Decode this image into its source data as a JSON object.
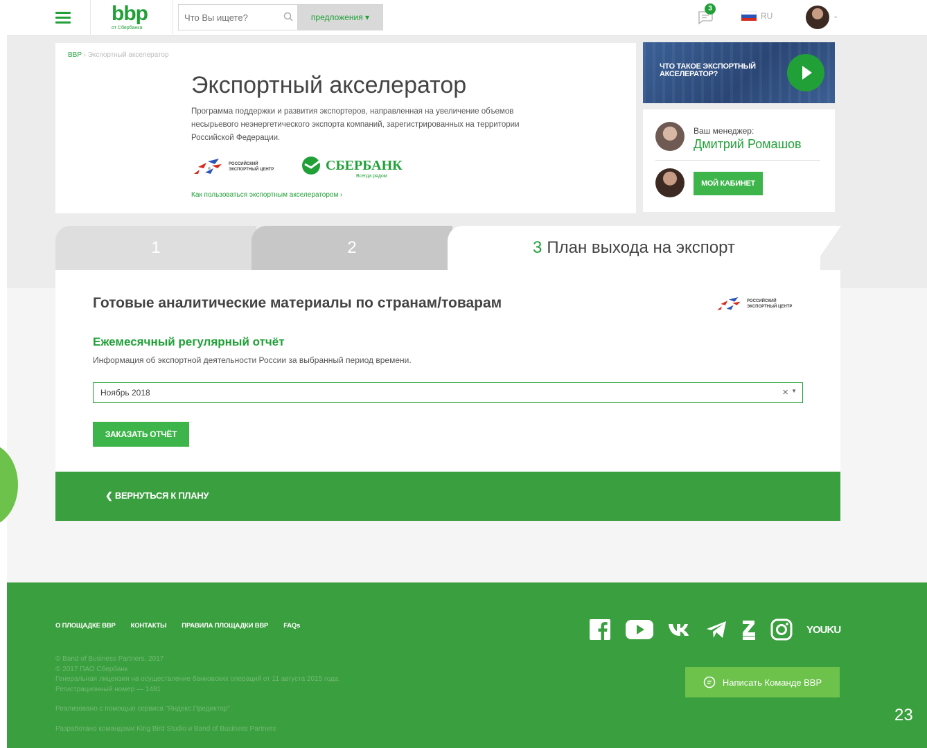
{
  "header": {
    "logo": "bbp",
    "logo_sub": "от Сбербанка",
    "search_placeholder": "Что Вы ищете?",
    "offers_label": "предложения ▾",
    "notifications_count": "3",
    "lang": "RU"
  },
  "top": {
    "breadcrumb": {
      "home": "BBP",
      "sep": " › ",
      "current": "Экспортный акселератор"
    },
    "title": "Экспортный акселератор",
    "description": "Программа поддержки и развития экспортеров, направленная на увеличение объемов несырьевого неэнергетического экспорта компаний, зарегистрированных на территории Российской Федерации.",
    "rec_logo_line1": "РОССИЙСКИЙ",
    "rec_logo_line2": "ЭКСПОРТНЫЙ ЦЕНТР",
    "sber_logo": "СБЕРБАНК",
    "sber_sub": "Всегда рядом",
    "how_link": "Как пользоваться экспортным акселератором ›"
  },
  "video": {
    "title": "ЧТО ТАКОЕ ЭКСПОРТНЫЙ АКСЕЛЕРАТОР?"
  },
  "manager": {
    "label": "Ваш менеджер:",
    "name": "Дмитрий Ромашов",
    "cabinet_button": "МОЙ КАБИНЕТ"
  },
  "tabs": [
    {
      "number": "1",
      "label": ""
    },
    {
      "number": "2",
      "label": ""
    },
    {
      "number": "3",
      "label": "План выхода на экспорт"
    }
  ],
  "panel": {
    "section_title": "Готовые аналитические материалы по странам/товарам",
    "rec_line1": "РОССИЙСКИЙ",
    "rec_line2": "ЭКСПОРТНЫЙ ЦЕНТР",
    "sub_title": "Ежемесячный регулярный отчёт",
    "sub_desc": "Информация об экспортной деятельности России за выбранный период времени.",
    "select_value": "Ноябрь 2018",
    "order_button": "ЗАКАЗАТЬ ОТЧЁТ"
  },
  "back_link": "❮ ВЕРНУТЬСЯ К ПЛАНУ",
  "footer": {
    "nav": [
      "О ПЛОЩАДКЕ BBP",
      "КОНТАКТЫ",
      "ПРАВИЛА ПЛОЩАДКИ BBP",
      "FAQs"
    ],
    "legal": [
      "© Band of Business Partners, 2017",
      "© 2017 ПАО Сбербанк",
      "Генеральная лицензия на осуществление банковских операций от 11 августа 2015 года.",
      "Регистрационный номер — 1481",
      "Реализовано с помощью сервиса \"Яндекс.Предиктор\"",
      "Разработано командами King Bird Studio и Band of Business Partners"
    ],
    "youku": "YOUKU",
    "write_button": "Написать Команде BBP"
  },
  "page_number": "23",
  "colors": {
    "accent": "#21a038",
    "button": "#3db54a",
    "footer": "#3a9f3e",
    "light_green": "#6cc24a"
  }
}
